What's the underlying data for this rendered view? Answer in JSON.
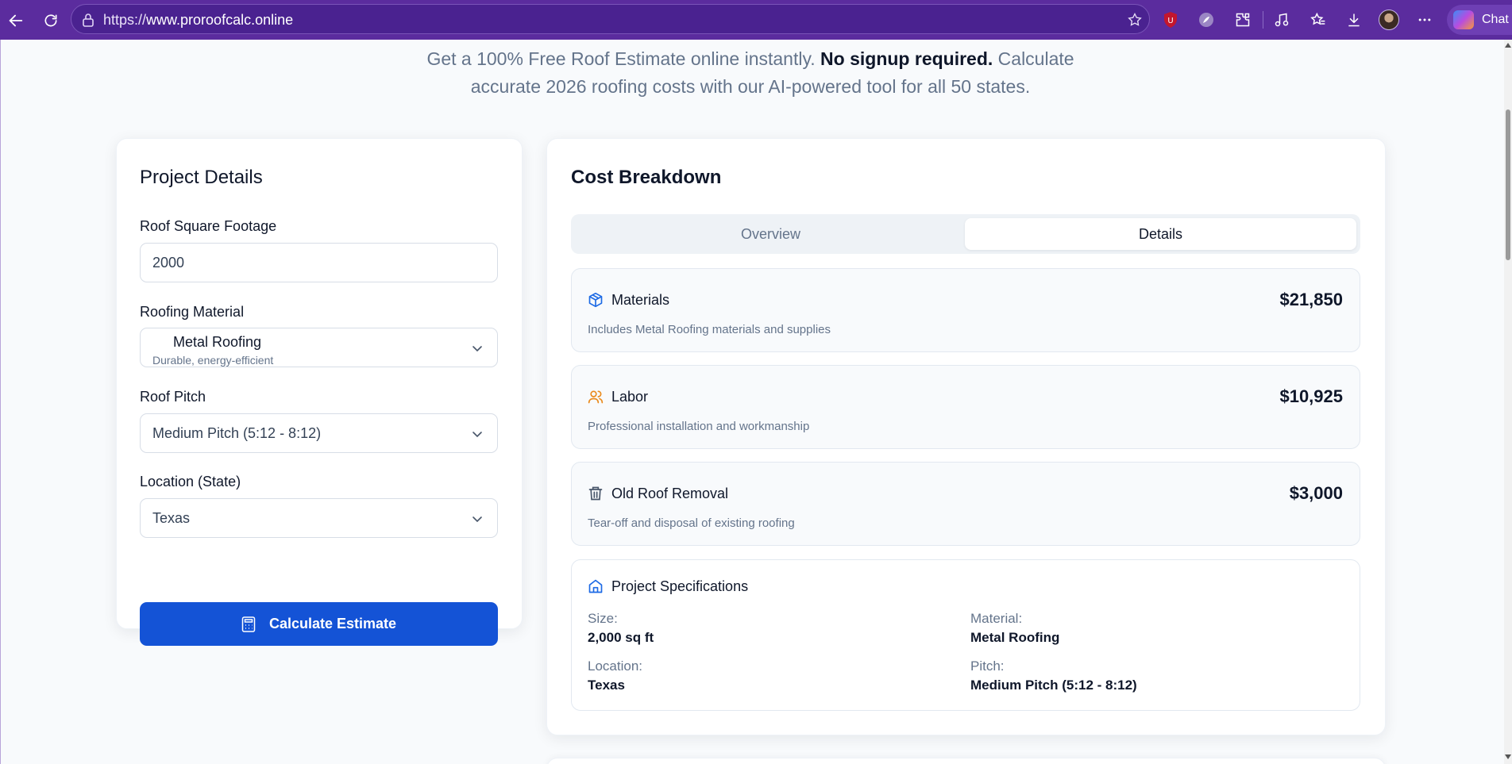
{
  "browser": {
    "url_prefix": "https://",
    "url_domain": "www.proroofcalc.online",
    "chat_label": "Chat"
  },
  "hero": {
    "line1_prefix": "Get a 100% Free Roof Estimate online instantly. ",
    "line1_strong": "No signup required.",
    "line1_suffix": " Calculate",
    "line2": "accurate 2026 roofing costs with our AI-powered tool for all 50 states."
  },
  "project_details": {
    "title": "Project Details",
    "square_footage": {
      "label": "Roof Square Footage",
      "value": "2000"
    },
    "material": {
      "label": "Roofing Material",
      "value": "Metal Roofing",
      "subtitle": "Durable, energy-efficient"
    },
    "pitch": {
      "label": "Roof Pitch",
      "value": "Medium Pitch (5:12 - 8:12)"
    },
    "location": {
      "label": "Location (State)",
      "value": "Texas"
    },
    "calculate_button": "Calculate Estimate"
  },
  "cost_breakdown": {
    "title": "Cost Breakdown",
    "tabs": [
      {
        "label": "Overview",
        "active": false
      },
      {
        "label": "Details",
        "active": true
      }
    ],
    "items": [
      {
        "icon": "package-icon",
        "title": "Materials",
        "amount": "$21,850",
        "description": "Includes Metal Roofing materials and supplies",
        "icon_color": "#1d6ae5"
      },
      {
        "icon": "users-icon",
        "title": "Labor",
        "amount": "$10,925",
        "description": "Professional installation and workmanship",
        "icon_color": "#ea8a1c"
      },
      {
        "icon": "trash-icon",
        "title": "Old Roof Removal",
        "amount": "$3,000",
        "description": "Tear-off and disposal of existing roofing",
        "icon_color": "#475569"
      }
    ],
    "specs": {
      "title": "Project Specifications",
      "size_label": "Size:",
      "size_value": "2,000 sq ft",
      "material_label": "Material:",
      "material_value": "Metal Roofing",
      "location_label": "Location:",
      "location_value": "Texas",
      "pitch_label": "Pitch:",
      "pitch_value": "Medium Pitch (5:12 - 8:12)"
    }
  },
  "colors": {
    "browser_bar": "#5b2c9e",
    "primary_button": "#1453d6",
    "heading": "#0f172a",
    "muted_text": "#64748b"
  }
}
